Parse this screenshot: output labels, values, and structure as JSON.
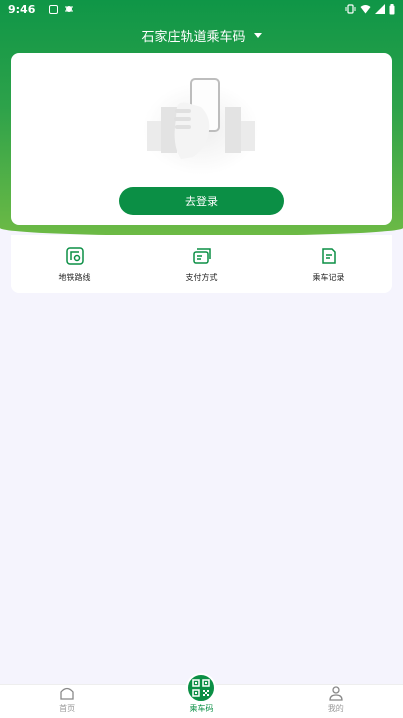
{
  "status_bar": {
    "time": "9:46"
  },
  "header": {
    "title": "石家庄轨道乘车码"
  },
  "card": {
    "login_label": "去登录"
  },
  "shortcuts": [
    {
      "label": "地铁路线",
      "icon": "metro-route-icon"
    },
    {
      "label": "支付方式",
      "icon": "payment-card-icon"
    },
    {
      "label": "乘车记录",
      "icon": "ride-record-icon"
    }
  ],
  "tabbar": [
    {
      "label": "首页",
      "icon": "home-icon"
    },
    {
      "label": "乘车码",
      "icon": "qr-code-icon"
    },
    {
      "label": "我的",
      "icon": "user-icon"
    }
  ],
  "colors": {
    "primary": "#0b8f45",
    "gradient_end": "#6dba45",
    "background": "#f5f4fd"
  }
}
